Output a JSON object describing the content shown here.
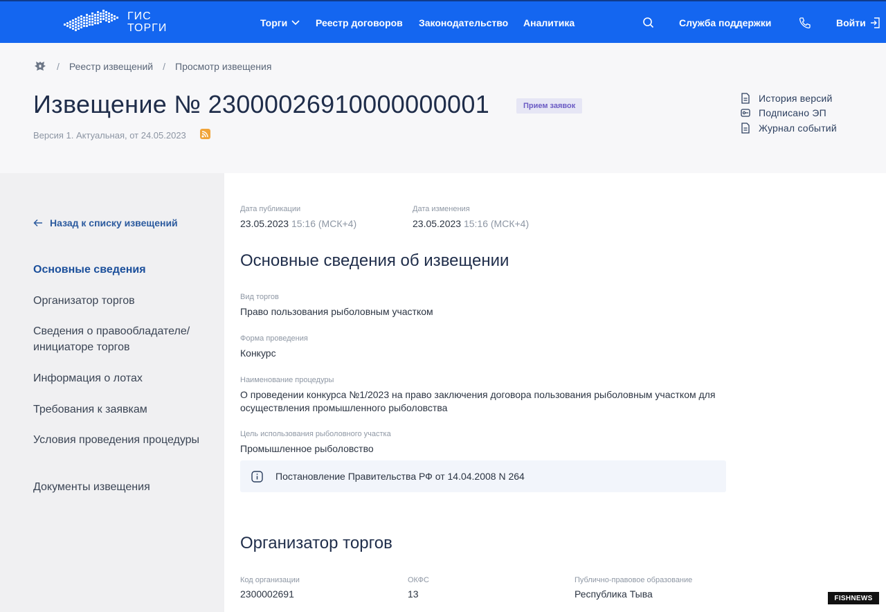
{
  "header": {
    "logo_line1": "ГИС",
    "logo_line2": "ТОРГИ",
    "nav": {
      "torgi": "Торги",
      "registry": "Реестр договоров",
      "law": "Законодательство",
      "analytics": "Аналитика",
      "support": "Служба поддержки",
      "login": "Войти"
    }
  },
  "breadcrumbs": {
    "item1": "Реестр извещений",
    "item2": "Просмотр извещения",
    "separator": "/"
  },
  "notice": {
    "title": "Извещение № 23000026910000000001",
    "status": "Прием заявок",
    "version": "Версия 1. Актуальная, от 24.05.2023"
  },
  "side_links": {
    "history": "История версий",
    "signed": "Подписано ЭП",
    "journal": "Журнал событий"
  },
  "left_menu": {
    "back": "Назад к списку извещений",
    "items": [
      "Основные сведения",
      "Организатор торгов",
      "Сведения о правообладателе/ инициаторе торгов",
      "Информация о лотах",
      "Требования к заявкам",
      "Условия проведения процедуры",
      "Документы извещения"
    ]
  },
  "dates": {
    "pub_label": "Дата публикации",
    "pub_date": "23.05.2023",
    "pub_time": "15:16 (МСК+4)",
    "mod_label": "Дата изменения",
    "mod_date": "23.05.2023",
    "mod_time": "15:16 (МСК+4)"
  },
  "section_main": {
    "heading": "Основные сведения об извещении",
    "type_label": "Вид торгов",
    "type_value": "Право пользования рыболовным участком",
    "form_label": "Форма проведения",
    "form_value": "Конкурс",
    "name_label": "Наименование процедуры",
    "name_line1": "О проведении конкурса №1/2023 на право заключения договора пользования рыболовным участком для",
    "name_line2": "осуществления промышленного рыболовства",
    "purpose_label": "Цель использования рыболовного участка",
    "purpose_value": "Промышленное рыболовство",
    "note": "Постановление Правительства РФ от 14.04.2008 N 264"
  },
  "section_org": {
    "heading": "Организатор торгов",
    "code_label": "Код организации",
    "code_value": "2300002691",
    "okfs_label": "ОКФС",
    "okfs_value": "13",
    "public_label": "Публично-правовое образование",
    "public_value": "Республика Тыва"
  },
  "watermark": "FISHNEWS",
  "colors": {
    "topbar": "#1466f0",
    "accent": "#1b4f9b",
    "badge_bg": "#e6e6f5",
    "badge_text": "#6b5bc4"
  }
}
